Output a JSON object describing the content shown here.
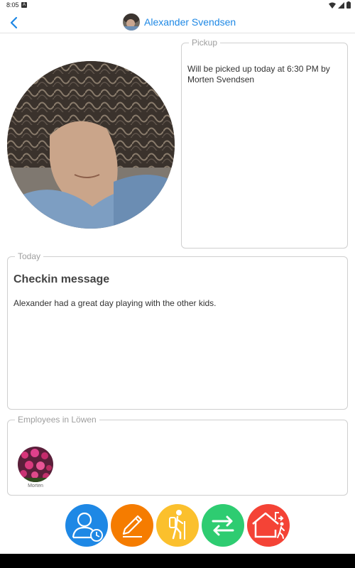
{
  "status_bar": {
    "time": "8:05",
    "notification_badge": "A"
  },
  "header": {
    "title": "Alexander Svendsen",
    "back_icon": "chevron-left-icon",
    "title_color": "#1e88e5"
  },
  "pickup": {
    "legend": "Pickup",
    "text": "Will be picked up today at 6:30 PM by Morten Svendsen"
  },
  "today": {
    "legend": "Today",
    "heading": "Checkin message",
    "message": "Alexander had a great day playing with the other kids."
  },
  "employees": {
    "legend": "Employees in Löwen",
    "items": [
      {
        "name": "Morten"
      }
    ]
  },
  "actions": [
    {
      "icon": "user-clock-icon",
      "color": "#1e88e5"
    },
    {
      "icon": "pencil-icon",
      "color": "#f57c00"
    },
    {
      "icon": "hiker-icon",
      "color": "#fbc02d"
    },
    {
      "icon": "swap-arrows-icon",
      "color": "#2ecc71"
    },
    {
      "icon": "house-exit-icon",
      "color": "#f44336"
    }
  ]
}
